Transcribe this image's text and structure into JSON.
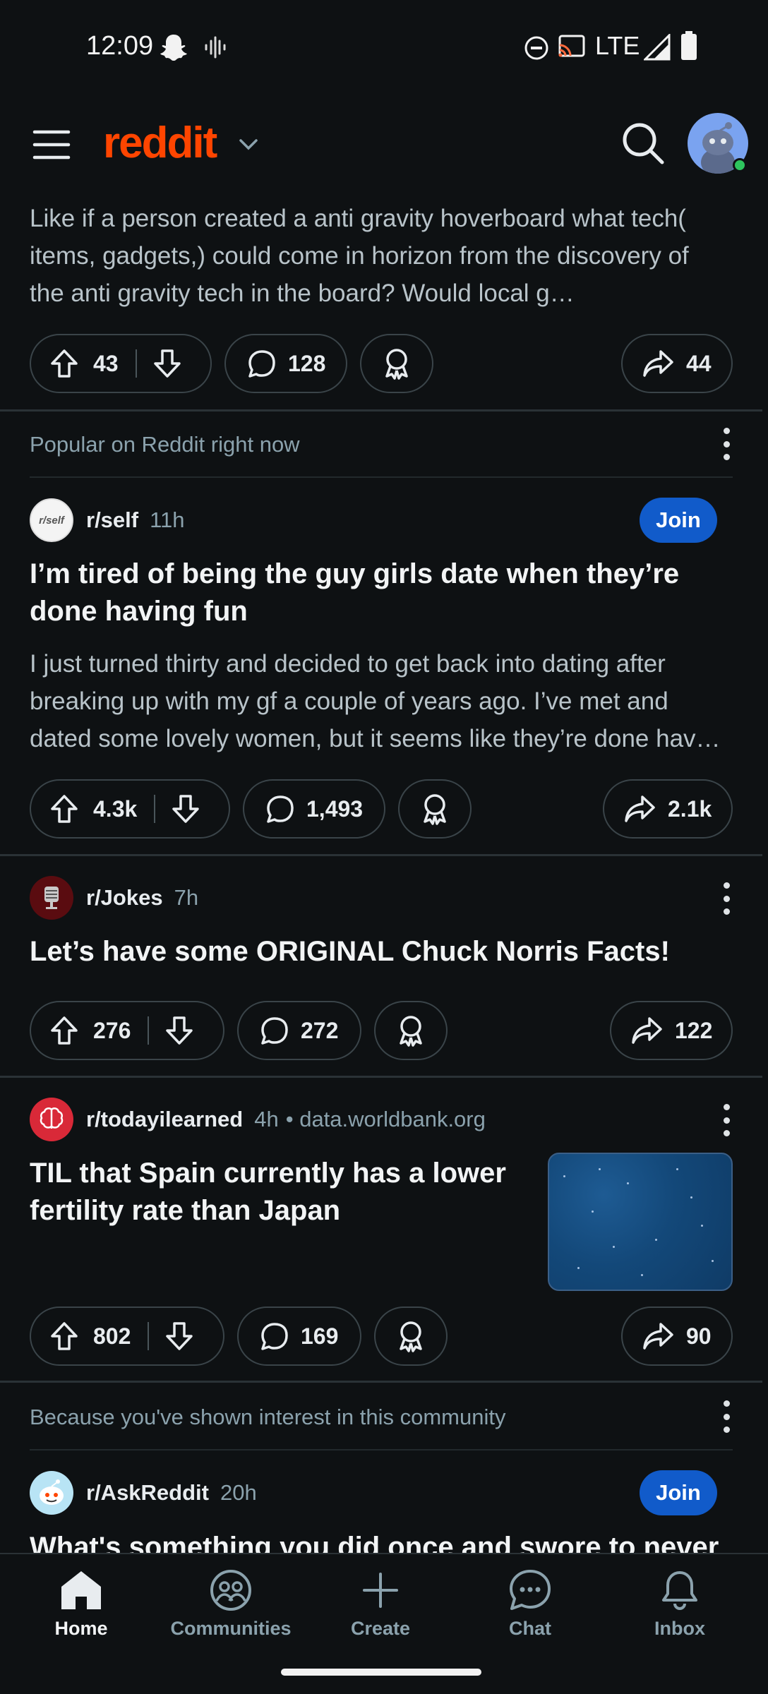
{
  "status_bar": {
    "time": "12:09",
    "network": "LTE"
  },
  "header": {
    "logo": "reddit"
  },
  "posts": [
    {
      "body": "Like if a person created a anti gravity hoverboard what tech( items, gadgets,) could come in horizon from the discovery of the anti gravity tech in the board? Would local g…",
      "upvotes": "43",
      "comments": "128",
      "shares": "44"
    },
    {
      "section_label": "Popular on Reddit right now",
      "subreddit": "r/self",
      "age": "11h",
      "join_label": "Join",
      "avatar_text": "r/self",
      "title": "I’m tired of being the guy girls date when they’re done having fun",
      "body": "I just turned thirty and decided to get back into dating after breaking up with my gf a couple of years ago. I’ve met and dated some lovely women, but it seems like they’re done hav…",
      "upvotes": "4.3k",
      "comments": "1,493",
      "shares": "2.1k"
    },
    {
      "subreddit": "r/Jokes",
      "age": "7h",
      "title": "Let’s have some ORIGINAL Chuck Norris Facts!",
      "upvotes": "276",
      "comments": "272",
      "shares": "122"
    },
    {
      "subreddit": "r/todayilearned",
      "age": "4h",
      "domain": "• data.worldbank.org",
      "title": "TIL that Spain currently has a lower fertility rate than Japan",
      "upvotes": "802",
      "comments": "169",
      "shares": "90"
    },
    {
      "section_label": "Because you've shown interest in this community",
      "subreddit": "r/AskReddit",
      "age": "20h",
      "join_label": "Join",
      "title": "What's something you did once and swore to never"
    }
  ],
  "bottom_nav": [
    {
      "label": "Home",
      "icon": "home-icon",
      "active": true
    },
    {
      "label": "Communities",
      "icon": "communities-icon",
      "active": false
    },
    {
      "label": "Create",
      "icon": "plus-icon",
      "active": false
    },
    {
      "label": "Chat",
      "icon": "chat-icon",
      "active": false
    },
    {
      "label": "Inbox",
      "icon": "bell-icon",
      "active": false
    }
  ],
  "colors": {
    "brand": "#ff4500",
    "join": "#115bca",
    "background": "#0e1113"
  }
}
